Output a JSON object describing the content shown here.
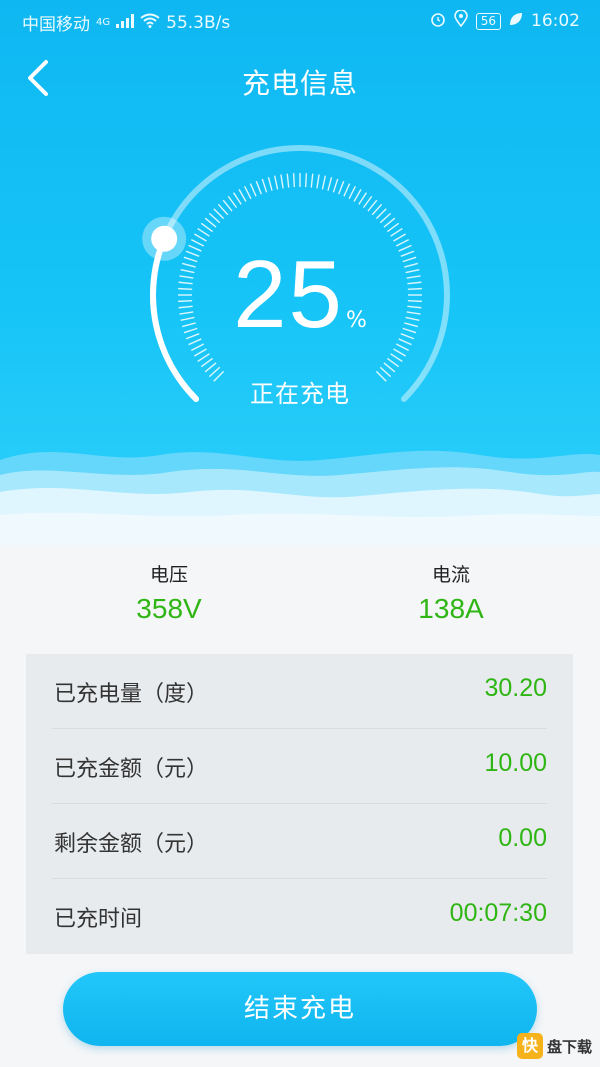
{
  "status_bar": {
    "carrier": "中国移动",
    "network": "4G",
    "speed": "55.3B/s",
    "battery": "56",
    "time": "16:02"
  },
  "header": {
    "title": "充电信息"
  },
  "gauge": {
    "percent": "25",
    "percent_unit": "%",
    "progress_fraction": 0.25,
    "status": "正在充电"
  },
  "metrics": {
    "voltage_label": "电压",
    "voltage_value": "358V",
    "current_label": "电流",
    "current_value": "138A"
  },
  "details": [
    {
      "label": "已充电量（度）",
      "value": "30.20"
    },
    {
      "label": "已充金额（元）",
      "value": "10.00"
    },
    {
      "label": "剩余金额（元）",
      "value": "0.00"
    },
    {
      "label": "已充时间",
      "value": "00:07:30"
    }
  ],
  "actions": {
    "end_button": "结束充电"
  },
  "watermark": {
    "logo_char": "快",
    "text": "盘下载"
  },
  "colors": {
    "accent": "#16c4f7",
    "value_green": "#2fb514"
  }
}
